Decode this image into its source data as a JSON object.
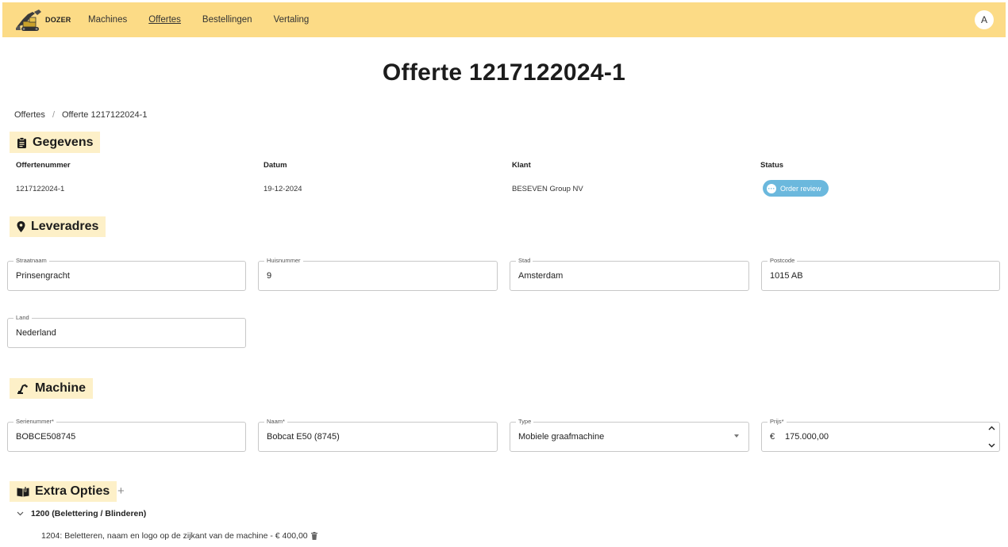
{
  "nav": {
    "logo_text": "DOZER",
    "items": [
      {
        "label": "Machines"
      },
      {
        "label": "Offertes",
        "active": true
      },
      {
        "label": "Bestellingen"
      },
      {
        "label": "Vertaling"
      }
    ],
    "avatar_initial": "A"
  },
  "page": {
    "title": "Offerte 1217122024-1",
    "breadcrumb": [
      "Offertes",
      "Offerte 1217122024-1"
    ]
  },
  "gegevens": {
    "heading": "Gegevens",
    "columns": [
      {
        "label": "Offertenummer",
        "value": "1217122024-1"
      },
      {
        "label": "Datum",
        "value": "19-12-2024"
      },
      {
        "label": "Klant",
        "value": "BESEVEN Group NV"
      },
      {
        "label": "Status"
      }
    ],
    "status": {
      "label": "Order review",
      "color": "#6bb8dd"
    }
  },
  "leveradres": {
    "heading": "Leveradres",
    "fields": [
      {
        "label": "Straatnaam",
        "value": "Prinsengracht"
      },
      {
        "label": "Huisnummer",
        "value": "9"
      },
      {
        "label": "Stad",
        "value": "Amsterdam"
      },
      {
        "label": "Postcode",
        "value": "1015 AB"
      },
      {
        "label": "Land",
        "value": "Nederland"
      }
    ]
  },
  "machine": {
    "heading": "Machine",
    "fields": [
      {
        "label": "Serienummer*",
        "value": "BOBCE508745"
      },
      {
        "label": "Naam*",
        "value": "Bobcat E50 (8745)"
      },
      {
        "label": "Type",
        "value": "Mobiele graafmachine"
      },
      {
        "label": "Prijs*",
        "currency": "€",
        "value": "175.000,00"
      }
    ]
  },
  "extra_opties": {
    "heading": "Extra Opties",
    "add_symbol": "+",
    "groups": [
      {
        "label": "1200 (Belettering / Blinderen)",
        "items": [
          {
            "label": "1204: Beletteren, naam en logo op de zijkant van de machine - € 400,00"
          }
        ]
      }
    ]
  },
  "colors": {
    "header_bg": "#fcdb86",
    "section_bg": "#fdf0c8",
    "status_bg": "#6bb8dd"
  }
}
